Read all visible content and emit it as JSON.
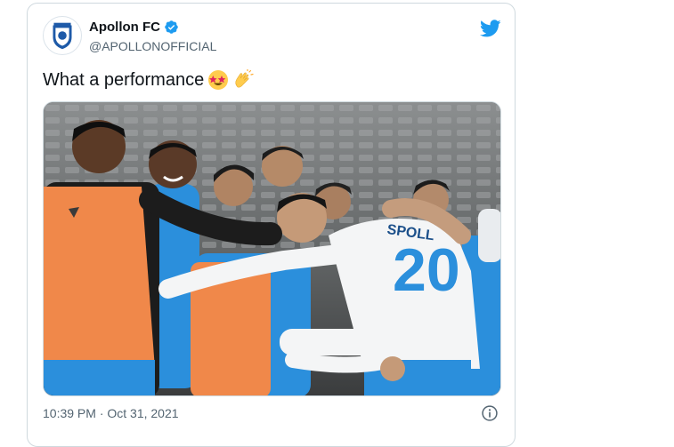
{
  "tweet": {
    "display_name": "Apollon FC",
    "handle": "@APOLLONOFFICIAL",
    "text": "What a performance",
    "emojis": [
      "star-struck-emoji",
      "clapping-hands-emoji"
    ],
    "timestamp": "10:39 PM · Oct 31, 2021",
    "jersey_number": "20",
    "jersey_name": "SPOLL"
  },
  "icons": {
    "verified": "verified-badge-icon",
    "brand": "twitter-bird-icon",
    "info": "info-icon"
  },
  "colors": {
    "twitter_blue": "#1d9bf0",
    "kit_blue": "#2b8fdc",
    "bib_orange": "#f0884a"
  }
}
